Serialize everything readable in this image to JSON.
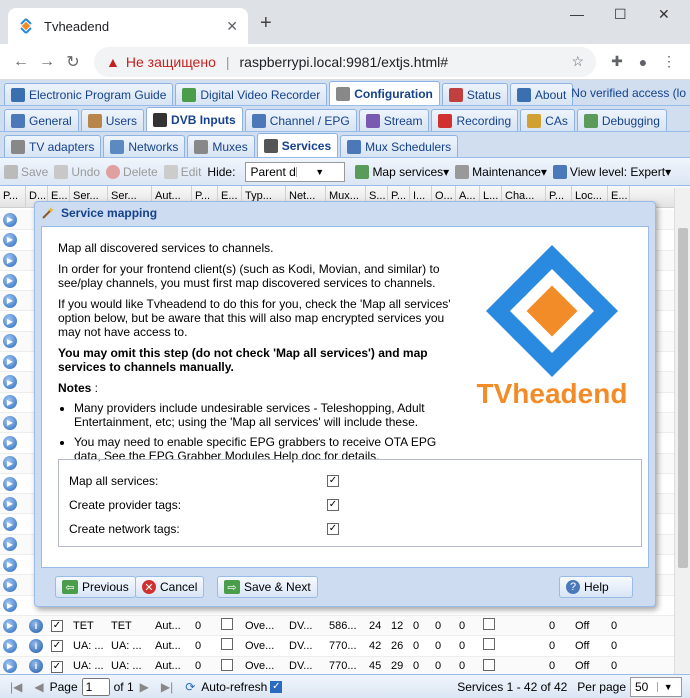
{
  "browser": {
    "tab_title": "Tvheadend",
    "new_tab": "+",
    "not_secure": "Не защищено",
    "url": "raspberrypi.local:9981/extjs.html#"
  },
  "top_tabs": [
    {
      "label": "Electronic Program Guide",
      "color": "#3a6fb0"
    },
    {
      "label": "Digital Video Recorder",
      "color": "#4a9d4a"
    },
    {
      "label": "Configuration",
      "color": "#888888",
      "active": true
    },
    {
      "label": "Status",
      "color": "#c04040"
    },
    {
      "label": "About",
      "color": "#3a6fb0"
    }
  ],
  "top_right": "No verified access   (lo",
  "sub_tabs": [
    {
      "label": "General",
      "color": "#4a78b8"
    },
    {
      "label": "Users",
      "color": "#b8864a"
    },
    {
      "label": "DVB Inputs",
      "color": "#333333",
      "active": true
    },
    {
      "label": "Channel / EPG",
      "color": "#4a78b8"
    },
    {
      "label": "Stream",
      "color": "#7a5ab0"
    },
    {
      "label": "Recording",
      "color": "#d03030"
    },
    {
      "label": "CAs",
      "color": "#d0a030"
    },
    {
      "label": "Debugging",
      "color": "#5a9a5a"
    }
  ],
  "dvb_tabs": [
    {
      "label": "TV adapters",
      "color": "#888888"
    },
    {
      "label": "Networks",
      "color": "#5a8ac0"
    },
    {
      "label": "Muxes",
      "color": "#888888"
    },
    {
      "label": "Services",
      "color": "#555555",
      "active": true
    },
    {
      "label": "Mux Schedulers",
      "color": "#4a78b8"
    }
  ],
  "toolbar": {
    "save": "Save",
    "undo": "Undo",
    "delete": "Delete",
    "edit": "Edit",
    "hide_label": "Hide:",
    "hide_value": "Parent disabled",
    "map_services": "Map services",
    "maintenance": "Maintenance",
    "view_level": "View level: Expert"
  },
  "grid_headers": [
    "P...",
    "D...",
    "E...",
    "Ser...",
    "Ser...",
    "Aut...",
    "P...",
    "E...",
    "Typ...",
    "Net...",
    "Mux...",
    "S...",
    "P...",
    "I...",
    "O...",
    "A...",
    "L...",
    "Cha...",
    "P...",
    "Loc...",
    "E..."
  ],
  "grid_rows": [
    [
      "TET",
      "TET",
      "Aut...",
      "0",
      "Ove...",
      "DV...",
      "586...",
      "24",
      "12",
      "0",
      "0",
      "0",
      "0",
      "Off",
      "0"
    ],
    [
      "UA: ...",
      "UA: ...",
      "Aut...",
      "0",
      "Ove...",
      "DV...",
      "770...",
      "42",
      "26",
      "0",
      "0",
      "0",
      "0",
      "Off",
      "0"
    ],
    [
      "UA: ...",
      "UA: ...",
      "Aut...",
      "0",
      "Ove...",
      "DV...",
      "770...",
      "45",
      "29",
      "0",
      "0",
      "0",
      "0",
      "Off",
      "0"
    ]
  ],
  "pager": {
    "page_label": "Page",
    "page_value": "1",
    "of": "of 1",
    "auto_refresh": "Auto-refresh",
    "summary": "Services 1 - 42 of 42",
    "per_page": "Per page",
    "per_page_value": "50"
  },
  "modal": {
    "title": "Service mapping",
    "p1": "Map all discovered services to channels.",
    "p2": "In order for your frontend client(s) (such as Kodi, Movian, and similar) to see/play channels, you must first map discovered services to channels.",
    "p3": "If you would like Tvheadend to do this for you, check the 'Map all services' option below, but be aware that this will also map encrypted services you may not have access to.",
    "p4": "You may omit this step (do not check 'Map all services') and map services to channels manually.",
    "notes": "Notes",
    "notes_sep": " :",
    "note1": "Many providers include undesirable services - Teleshopping, Adult Entertainment, etc; using the 'Map all services' will include these.",
    "note2": "You may need to enable specific EPG grabbers to receive OTA EPG data, See the EPG Grabber Modules Help doc for details.",
    "logo_text": "TVheadend",
    "fields": [
      {
        "label": "Map all services:",
        "checked": true
      },
      {
        "label": "Create provider tags:",
        "checked": true
      },
      {
        "label": "Create network tags:",
        "checked": true
      }
    ],
    "buttons": {
      "previous": "Previous",
      "cancel": "Cancel",
      "save_next": "Save & Next",
      "help": "Help"
    }
  }
}
